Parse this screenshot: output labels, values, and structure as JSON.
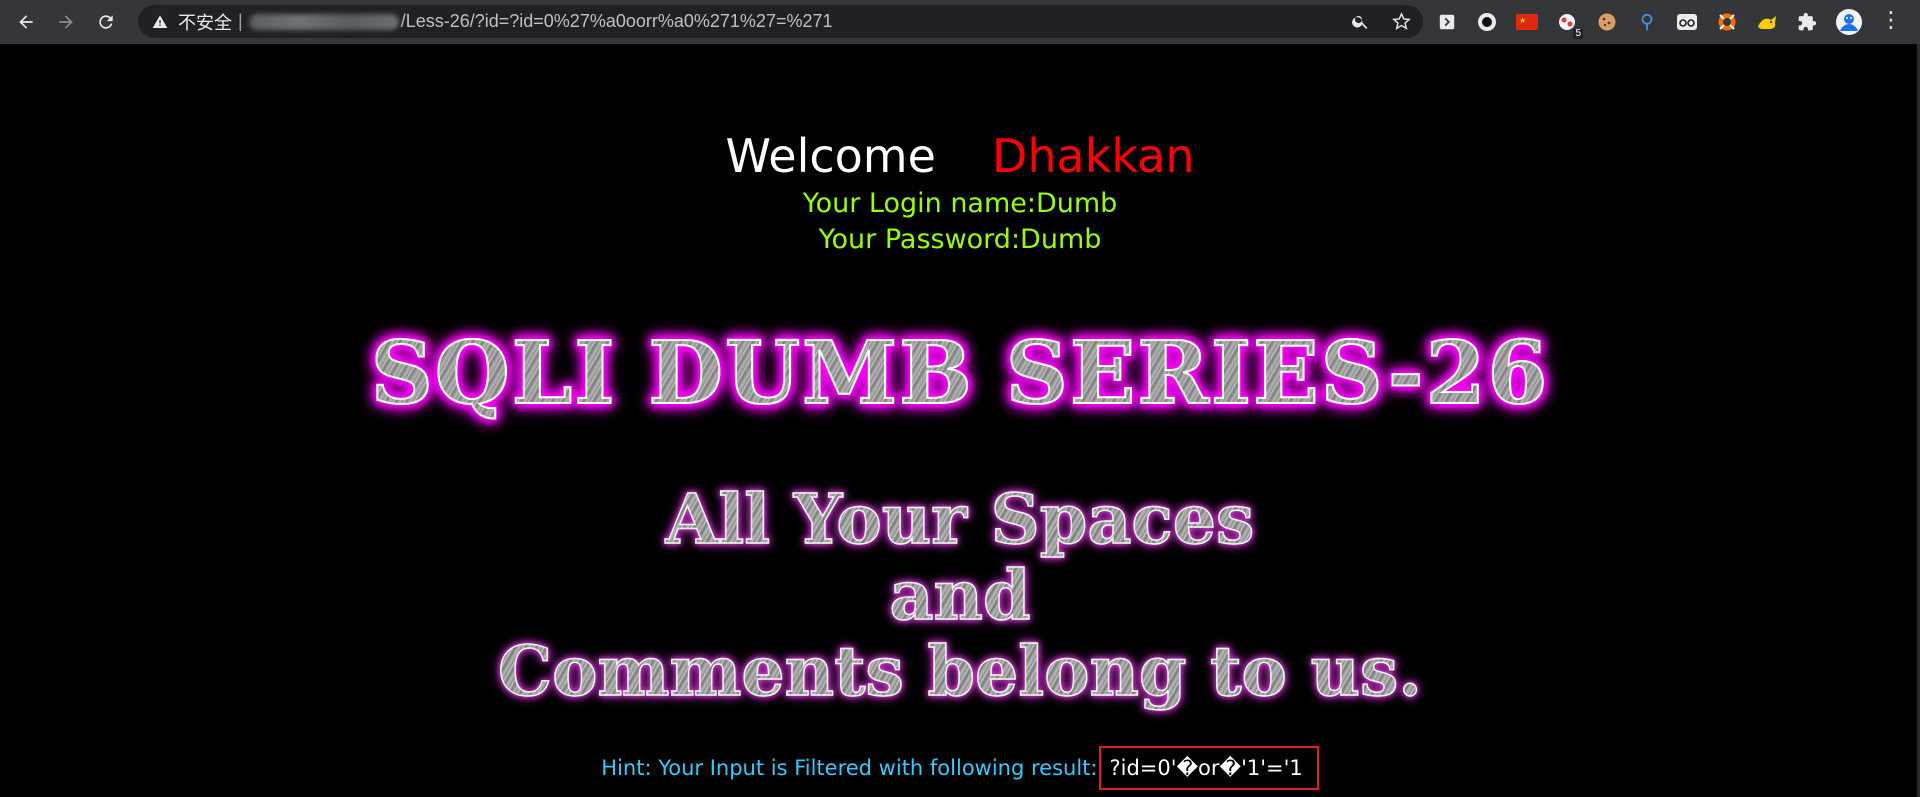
{
  "browser": {
    "security_label": "不安全",
    "separator": "|",
    "url_path": "/Less-26/?id=?id=0%27%a0oorr%a0%271%27=%271",
    "extension_badge": "5",
    "menu_glyph": "⋮",
    "icons": [
      "back-icon",
      "forward-icon",
      "reload-icon",
      "warning-icon",
      "zoom-icon",
      "star-icon",
      "puzzle-icon",
      "profile-avatar-icon"
    ]
  },
  "page": {
    "welcome": "Welcome",
    "username": "Dhakkan",
    "login_line": "Your Login name:Dumb",
    "password_line": "Your Password:Dumb",
    "series_title": "SQLI DUMB SERIES-26",
    "tagline": [
      "All Your Spaces",
      "and",
      "Comments belong to us."
    ],
    "hint_label": "Hint: Your Input is Filtered with following result:",
    "hint_result": "?id=0'�or�'1'='1"
  },
  "colors": {
    "background": "#000000",
    "welcome": "#ffffff",
    "username": "#ff0000",
    "info": "#99ff00",
    "hint": "#33ccff",
    "highlight_box": "#e02020",
    "title_glow": "#ff00ff"
  }
}
